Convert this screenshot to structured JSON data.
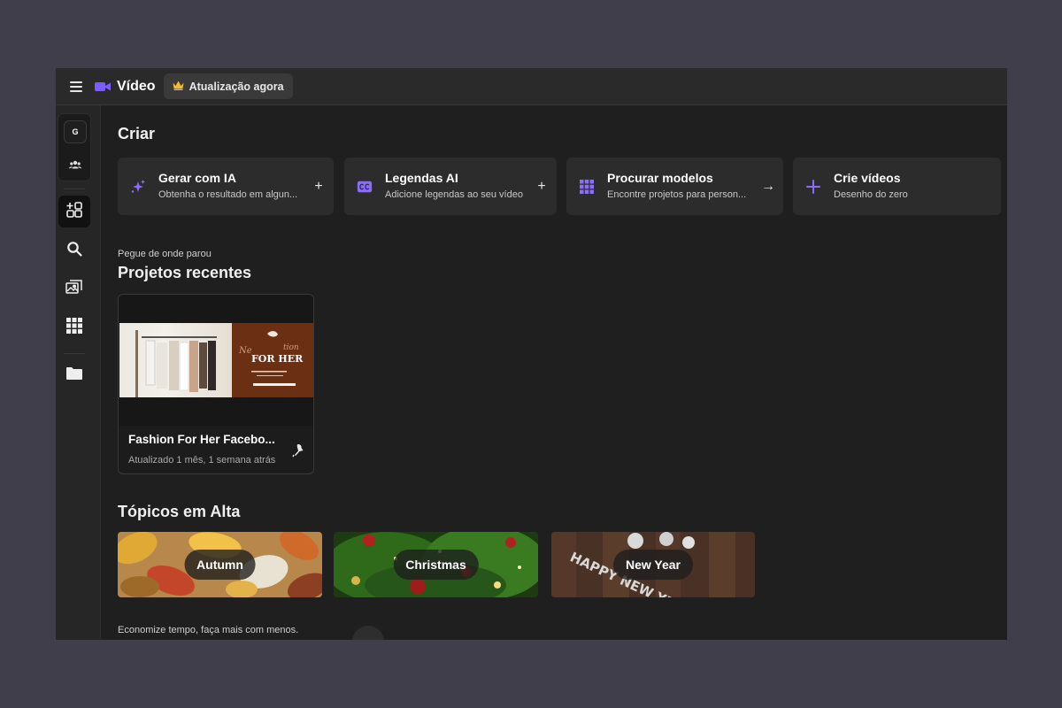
{
  "app": {
    "title": "Vídeo",
    "upgrade_label": "Atualização agora",
    "accent": "#7c5cff",
    "crown_color": "#f5b82e"
  },
  "sidebar": {
    "team_initial": "G",
    "items": [
      {
        "name": "create-icon",
        "active": true
      },
      {
        "name": "search-icon",
        "active": false
      },
      {
        "name": "media-icon",
        "active": false
      },
      {
        "name": "templates-grid-icon",
        "active": false
      },
      {
        "name": "folder-icon",
        "active": false
      }
    ]
  },
  "create": {
    "title": "Criar",
    "cards": [
      {
        "title": "Gerar com IA",
        "subtitle": "Obtenha o resultado em algun...",
        "icon": "sparkles-icon",
        "action": "+"
      },
      {
        "title": "Legendas AI",
        "subtitle": "Adicione legendas ao seu vídeo",
        "icon": "captions-icon",
        "action": "+"
      },
      {
        "title": "Procurar modelos",
        "subtitle": "Encontre projetos para person...",
        "icon": "grid-icon",
        "action": "→"
      },
      {
        "title": "Crie vídeos",
        "subtitle": "Desenho do zero",
        "icon": "plus-icon",
        "action": ""
      }
    ]
  },
  "recent": {
    "caption": "Pegue de onde parou",
    "title": "Projetos recentes",
    "projects": [
      {
        "title": "Fashion For Her Facebo...",
        "updated": "Atualizado 1 mês, 1 semana atrás",
        "thumb_text": "FOR HER"
      }
    ]
  },
  "trending": {
    "title": "Tópicos em Alta",
    "topics": [
      {
        "label": "Autumn"
      },
      {
        "label": "Christmas"
      },
      {
        "label": "New Year",
        "background_text": "HAPPY NEW YEAR"
      }
    ]
  },
  "footer": {
    "text": "Economize tempo, faça mais com menos."
  }
}
